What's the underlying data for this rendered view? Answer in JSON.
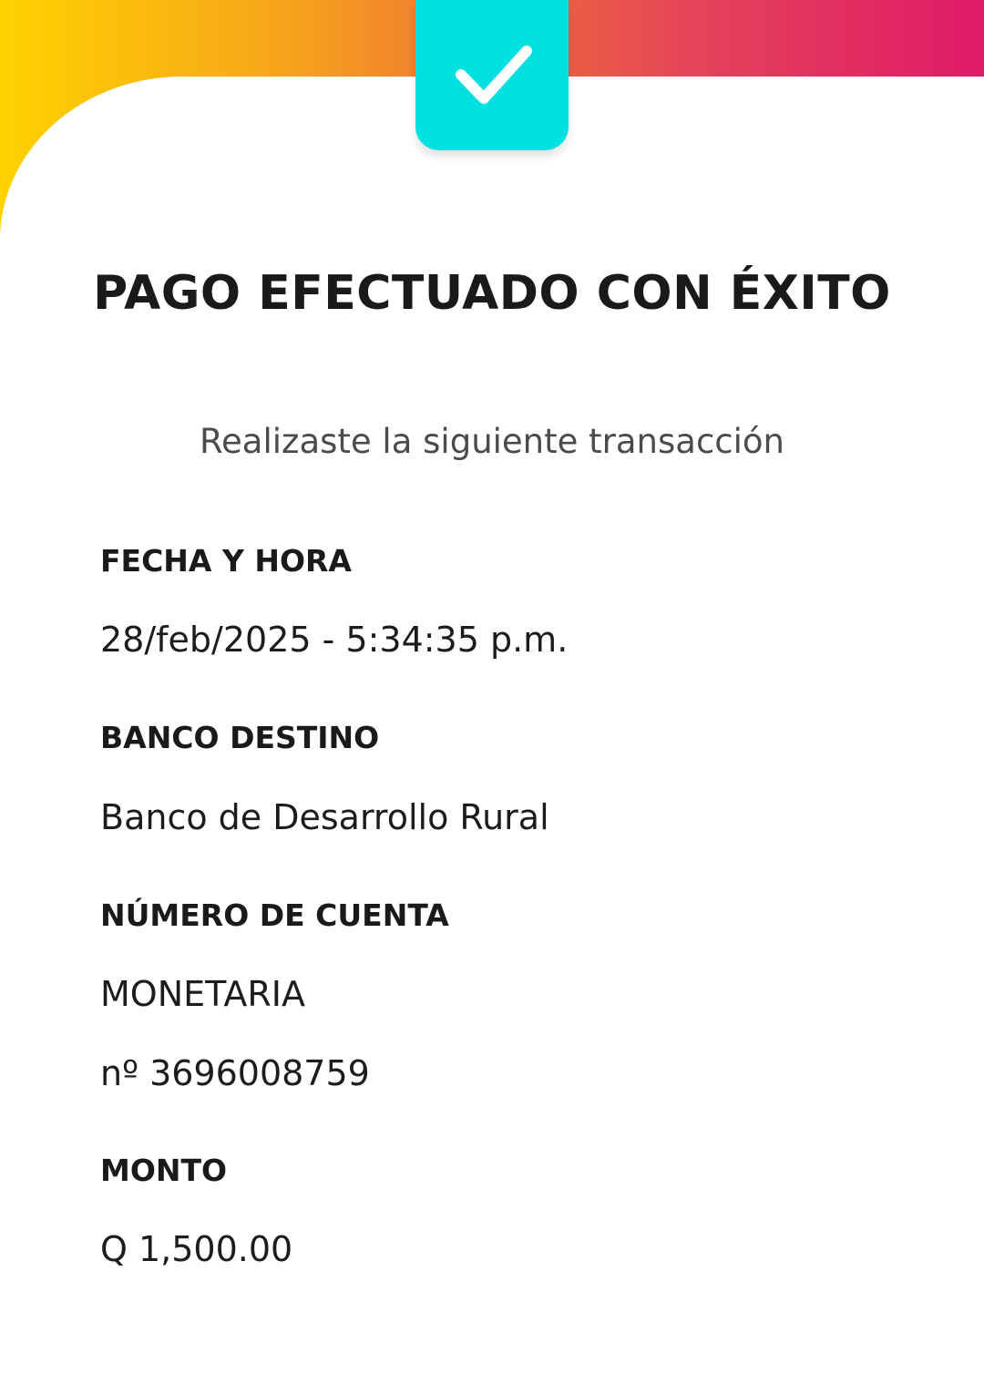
{
  "header": {
    "icon": "checkmark-icon",
    "gradient_colors": [
      "#ffd200",
      "#f6a21c",
      "#ee6a3a",
      "#e5445a",
      "#df1a68"
    ],
    "badge_color": "#00e0e0"
  },
  "title": "PAGO EFECTUADO CON ÉXITO",
  "subtitle": "Realizaste la siguiente transacción",
  "details": {
    "fecha_label": "FECHA Y HORA",
    "fecha_value": " 28/feb/2025 - 5:34:35 p.m.",
    "banco_label": "BANCO DESTINO",
    "banco_value": "Banco de Desarrollo Rural",
    "cuenta_label": "NÚMERO DE CUENTA",
    "cuenta_tipo": "MONETARIA",
    "cuenta_numero": "nº 3696008759",
    "monto_label": "MONTO",
    "monto_value": "Q 1,500.00"
  }
}
